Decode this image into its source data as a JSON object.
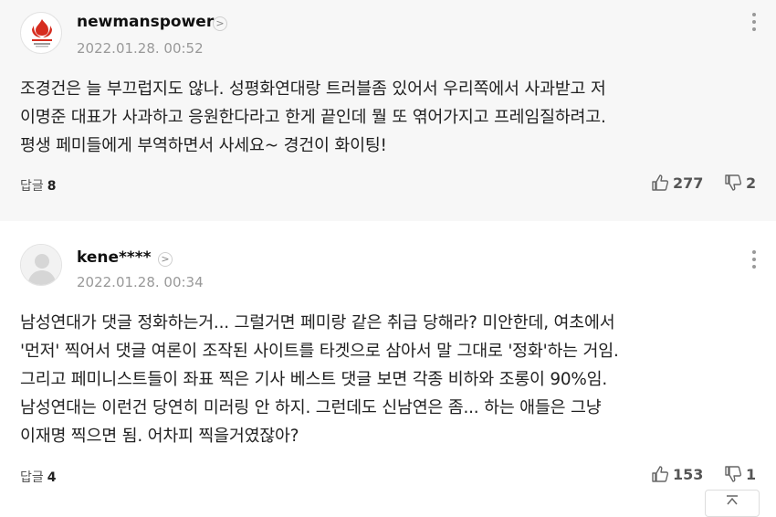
{
  "comments": [
    {
      "author": "newmanspower",
      "date": "2022.01.28. 00:52",
      "avatar_icon": "red-flame-logo",
      "body": "조경건은 늘 부끄럽지도 않나. 성평화연대랑 트러블좀 있어서 우리쪽에서 사과받고 저\n이명준 대표가 사과하고 응원한다라고 한게 끝인데 뭘 또 엮어가지고 프레임질하려고.\n평생 페미들에게 부역하면서 사세요~ 경건이 화이팅!",
      "reply_label": "답글",
      "reply_count": "8",
      "likes": "277",
      "dislikes": "2"
    },
    {
      "author": "kene****",
      "date": "2022.01.28. 00:34",
      "avatar_icon": "default-user-avatar",
      "body": "남성연대가 댓글 정화하는거... 그럴거면 페미랑 같은 취급 당해라? 미안한데, 여초에서\n'먼저' 찍어서 댓글 여론이 조작된 사이트를 타겟으로 삼아서 말 그대로 '정화'하는 거임.\n그리고 페미니스트들이 좌표 찍은 기사 베스트 댓글 보면 각종 비하와 조롱이 90%임.\n남성연대는 이런건 당연히 미러링 안 하지. 그런데도 신남연은 좀... 하는 애들은 그냥\n이재명 찍으면 됨. 어차피 찍을거였잖아?",
      "reply_label": "답글",
      "reply_count": "4",
      "likes": "153",
      "dislikes": "1"
    }
  ],
  "icons": {
    "author_chevron": ">",
    "thumbs_up": "thumbs-up-icon",
    "thumbs_down": "thumbs-down-icon",
    "more": "more-vertical-icon",
    "scroll_top": "arrow-up-icon"
  },
  "colors": {
    "first_comment_bg": "#f7f7f7",
    "second_comment_bg": "#ffffff",
    "logo_red": "#d62c1f"
  }
}
